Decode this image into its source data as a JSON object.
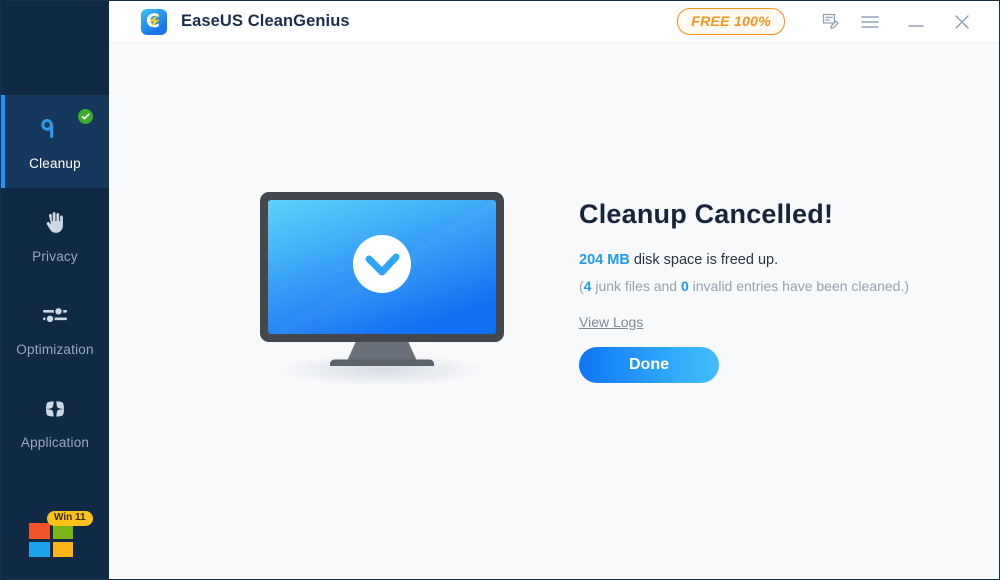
{
  "window": {
    "app_title": "EaseUS CleanGenius",
    "logo_icon": "cleangenius-logo-icon"
  },
  "titlebar": {
    "free_badge": "FREE 100%",
    "icons": [
      {
        "name": "feedback-icon",
        "title": "Feedback"
      },
      {
        "name": "menu-icon",
        "title": "Menu"
      },
      {
        "name": "minimize-icon",
        "title": "Minimize"
      },
      {
        "name": "close-icon",
        "title": "Close"
      }
    ]
  },
  "sidebar": {
    "items": [
      {
        "label": "Cleanup",
        "icon": "broom-icon",
        "active": true,
        "badge": "check-badge"
      },
      {
        "label": "Privacy",
        "icon": "hand-icon",
        "active": false
      },
      {
        "label": "Optimization",
        "icon": "sliders-icon",
        "active": false
      },
      {
        "label": "Application",
        "icon": "clover-grid-icon",
        "active": false
      }
    ],
    "os_badge": {
      "label": "Win 11",
      "icon": "windows-logo-icon"
    }
  },
  "main": {
    "illustration": "monitor-with-check-icon",
    "headline": "Cleanup Cancelled!",
    "result_value": "204",
    "result_unit": "MB",
    "result_text": " disk space is freed up.",
    "detail_prefix": "(",
    "detail_junk_count": "4",
    "detail_mid": " junk files and ",
    "detail_invalid_count": "0",
    "detail_suffix": " invalid entries have been cleaned.)",
    "view_logs_label": "View Logs",
    "done_label": "Done"
  },
  "colors": {
    "sidebar_bg": "#102a45",
    "sidebar_active_bg": "#16385c",
    "accent_blue": "#1e9bf5",
    "indicator_blue": "#2196f3",
    "badge_orange": "#f5941f",
    "badge_green": "#3fae2a",
    "content_bg": "#f8f9fb"
  }
}
